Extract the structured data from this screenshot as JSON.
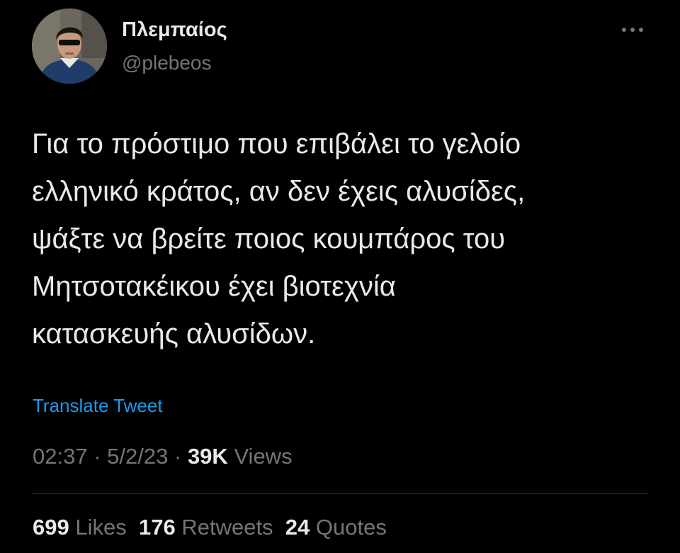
{
  "author": {
    "display_name": "Πλεμπαίος",
    "handle": "@plebeos",
    "avatar_icon": "profile-photo"
  },
  "more_icon": "ellipsis-icon",
  "tweet": {
    "text_lines": [
      "Για το πρόστιμο που επιβάλει το γελοίο",
      "ελληνικό κράτος, αν δεν έχεις αλυσίδες,",
      "ψάξτε να βρείτε ποιος κουμπάρος του",
      "Μητσοτακέικου έχει βιοτεχνία",
      "κατασκευής αλυσίδων."
    ],
    "translate_label": "Translate Tweet"
  },
  "meta": {
    "time": "02:37",
    "separator": "·",
    "date": "5/2/23",
    "views_count": "39K",
    "views_label": "Views"
  },
  "stats": {
    "likes_count": "699",
    "likes_label": "Likes",
    "retweets_count": "176",
    "retweets_label": "Retweets",
    "quotes_count": "24",
    "quotes_label": "Quotes"
  },
  "colors": {
    "background": "#000000",
    "text_primary": "#e7e9ea",
    "text_secondary": "#71767b",
    "link": "#1d9bf0",
    "divider": "#2f3336"
  }
}
